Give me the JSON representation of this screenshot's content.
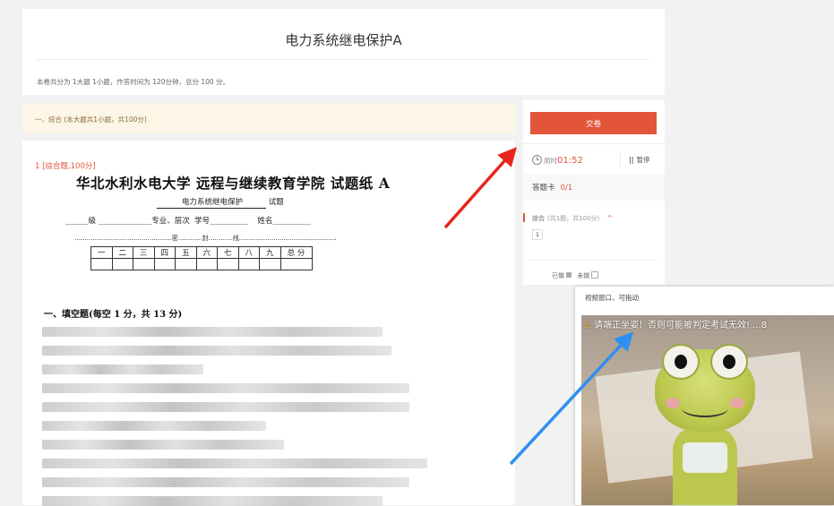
{
  "header": {
    "title": "电力系统继电保护A",
    "summary": "本卷共分为 1大题 1小题，作答时间为 120分钟，总分 100 分。"
  },
  "section": {
    "label": "一、综合 (本大题共1小题，共100分)"
  },
  "question": {
    "tag": "1 [综合题,100分]",
    "paper": {
      "school": "华北水利水电大学 远程与继续教育学院 试题纸 A",
      "course_name": "电力系统继电保护",
      "course_suffix": "试题",
      "fields": "______级 ______________专业、层次  学号__________    姓名__________",
      "seal_line": "…………………………………………密…………封…………线…………………………………………",
      "score_headers": [
        "一",
        "二",
        "三",
        "四",
        "五",
        "六",
        "七",
        "八",
        "九",
        "总 分"
      ],
      "fill_heading": "一、填空题(每空 1 分，共 13 分)"
    }
  },
  "panel": {
    "submit_label": "交卷",
    "timer_prefix": "用时",
    "timer_value": "01:52",
    "pause_label": "暂停",
    "pause_icon": "||",
    "answer_card_title": "答题卡",
    "answer_card_count": "0/1",
    "group_name": "综合",
    "group_detail": "(共1题，共100分)",
    "group_chevron": "^",
    "question_number": "1",
    "legend_done": "已做",
    "legend_todo": "未做"
  },
  "video": {
    "title": "视频窗口，可拖动",
    "warning_icon": "⚠",
    "warning_text": "请端正坐姿！否则可能被判定考试无效! ...8"
  },
  "colors": {
    "accent": "#e2553b",
    "section_bg": "#fdf6e6",
    "arrow_red": "#e8261c",
    "arrow_blue": "#2f8ff0"
  }
}
